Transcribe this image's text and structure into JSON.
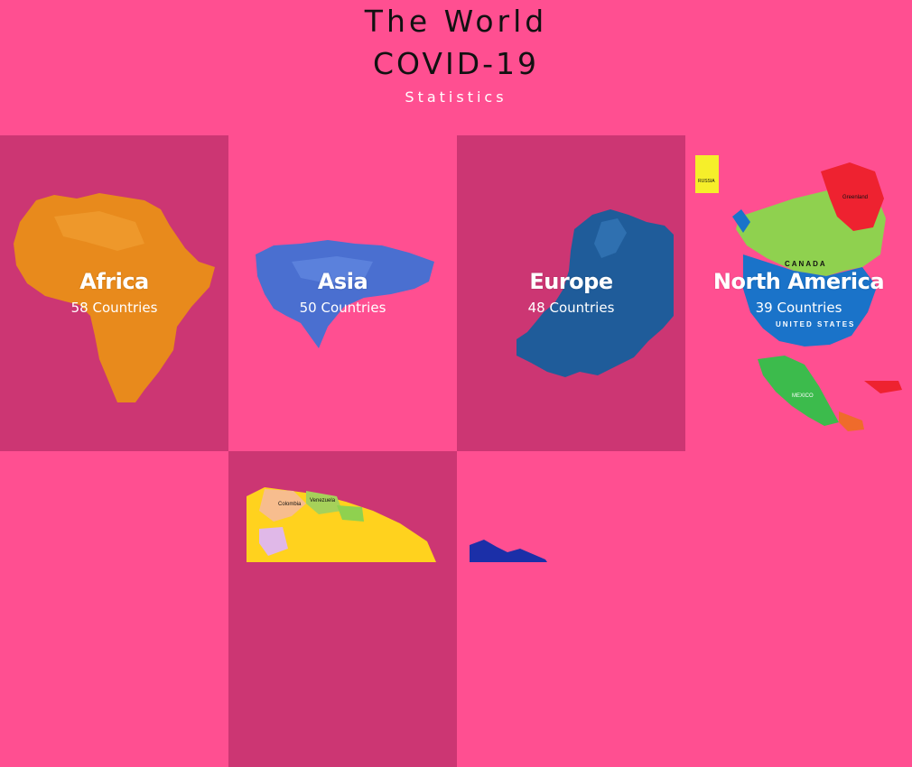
{
  "header": {
    "title_line1": "The World",
    "title_line2": "COVID-19",
    "subtitle": "Statistics"
  },
  "continents": [
    {
      "name": "Africa",
      "count": "58 Countries",
      "map": "africa-map"
    },
    {
      "name": "Asia",
      "count": "50 Countries",
      "map": "asia-map"
    },
    {
      "name": "Europe",
      "count": "48 Countries",
      "map": "europe-map"
    },
    {
      "name": "North America",
      "count": "39 Countries",
      "map": "north-america-map"
    }
  ],
  "map_labels": {
    "canada": "CANADA",
    "united_states": "UNITED STATES",
    "mexico": "MEXICO",
    "russia": "RUSSIA",
    "greenland": "Greenland",
    "venezuela": "Venezuela",
    "colombia": "Colombia"
  },
  "colors": {
    "background": "#ff4f91",
    "tile_dark": "#cc3673",
    "africa": "#e88a1c",
    "asia": "#4a6fd0",
    "europe": "#1f5c9a"
  }
}
